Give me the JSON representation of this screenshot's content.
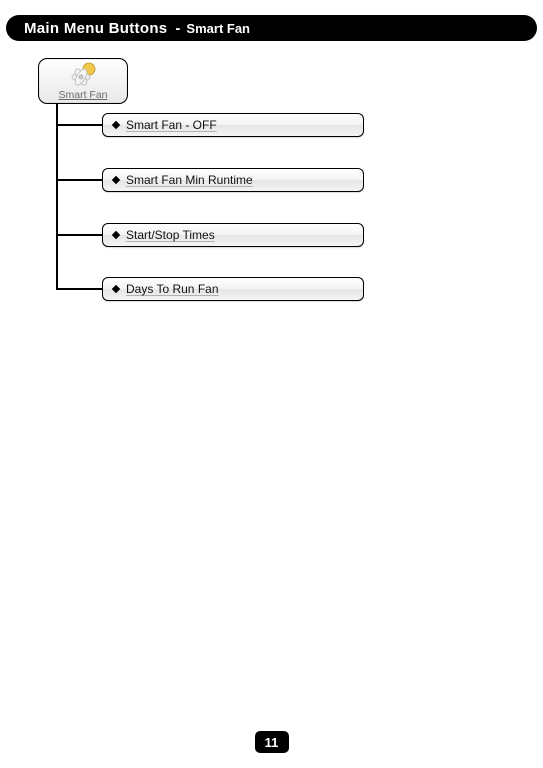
{
  "header": {
    "main": "Main Menu Buttons",
    "separator": "-",
    "sub": "Smart Fan"
  },
  "tree": {
    "root": {
      "label": "Smart Fan"
    },
    "children": [
      {
        "label": "Smart Fan - OFF"
      },
      {
        "label": "Smart Fan Min Runtime"
      },
      {
        "label": "Start/Stop Times"
      },
      {
        "label": "Days To Run Fan"
      }
    ]
  },
  "page_number": "11"
}
